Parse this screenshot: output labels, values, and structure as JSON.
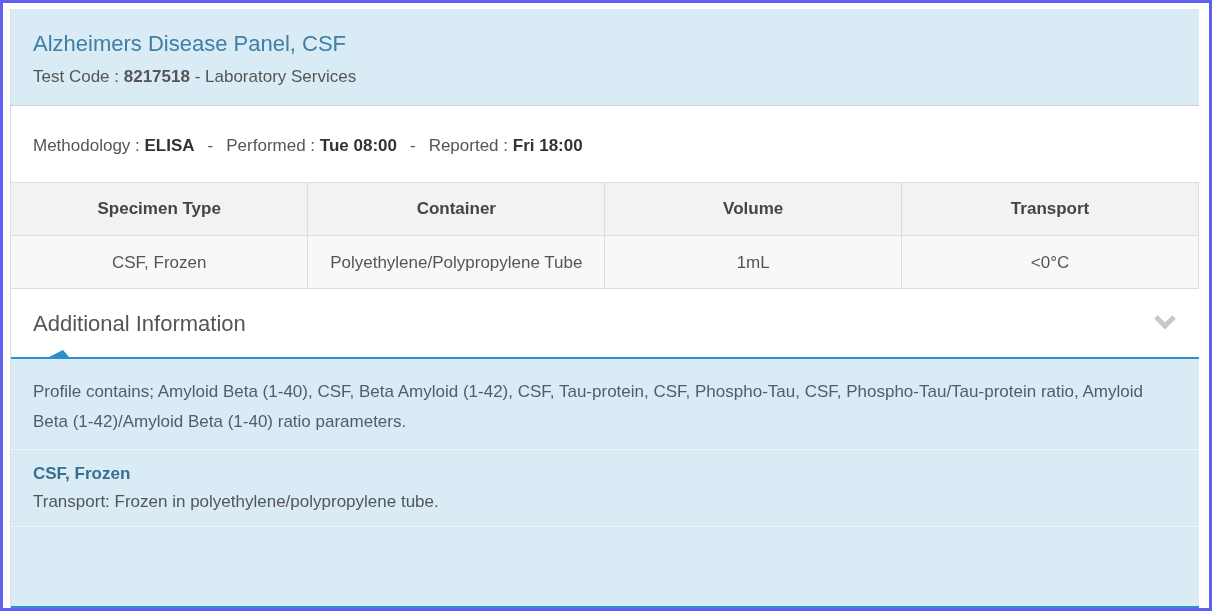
{
  "header": {
    "title": "Alzheimers Disease Panel, CSF",
    "subtitle": "Test Code : **8217518** - Laboratory Services"
  },
  "schedule": [
    {
      "label": "Methodology :",
      "value": "ELISA"
    },
    {
      "label": "Performed :",
      "value": "Tue 08:00"
    },
    {
      "label": "Reported :",
      "value": "Fri 18:00"
    }
  ],
  "separator": "-",
  "table": {
    "columns": [
      "Specimen Type",
      "Container",
      "Volume",
      "Transport"
    ],
    "rows": [
      [
        "CSF, Frozen",
        "Polyethylene/Polypropylene Tube",
        "1mL",
        "<0°C"
      ]
    ]
  },
  "additional": {
    "title": "Additional Information",
    "expanded": true,
    "profile": "Profile contains; Amyloid Beta (1-40), CSF, Beta Amyloid (1-42), CSF, Tau-protein, CSF, Phospho-Tau, CSF, Phospho-Tau/Tau-protein ratio, Amyloid Beta (1-42)/Amyloid Beta (1-40) ratio parameters.",
    "notes": [
      {
        "heading": "CSF, Frozen",
        "text": "Transport: Frozen in polyethylene/polypropylene tube."
      }
    ]
  }
}
